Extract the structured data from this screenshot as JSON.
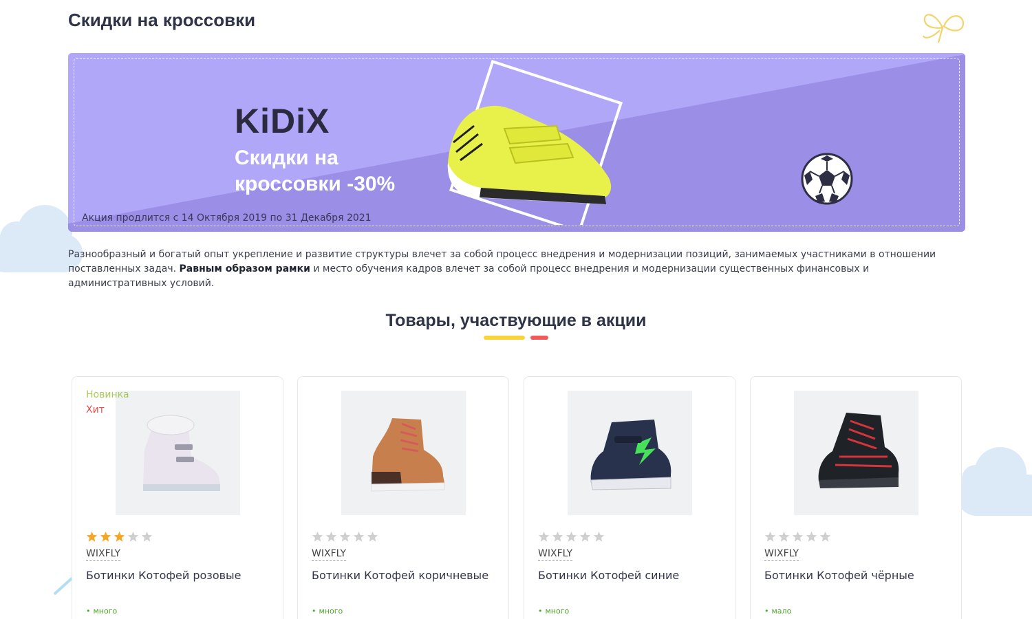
{
  "page": {
    "title": "Скидки на кроссовки"
  },
  "banner": {
    "brand": "KiDiX",
    "promo_line1": "Скидки на",
    "promo_line2": "кроссовки -30%",
    "dates": "Акция продлится с 14 Октября 2019 по 31 Декабря 2021",
    "colors": {
      "light": "#b1a7f9",
      "dark": "#9a8ee6",
      "shoe": "#e8f04a"
    }
  },
  "description": {
    "part1": "Разнообразный и богатый опыт укрепление и развитие структуры влечет за собой процесс внедрения и модернизации позиций, занимаемых участниками в отношении поставленных задач. ",
    "bold": "Равным образом рамки",
    "part2": " и место обучения кадров влечет за собой процесс внедрения и модернизации существенных финансовых и административных условий."
  },
  "section": {
    "title": "Товары, участвующие в акции"
  },
  "products": [
    {
      "badge_new": "Новинка",
      "badge_hit": "Хит",
      "rating": 3,
      "brand": "WIXFLY",
      "name": "Ботинки Котофей розовые",
      "stock": "много",
      "color": "#e9e4ee"
    },
    {
      "rating": 0,
      "brand": "WIXFLY",
      "name": "Ботинки Котофей коричневые",
      "stock": "много",
      "color": "#c7804d"
    },
    {
      "rating": 0,
      "brand": "WIXFLY",
      "name": "Ботинки Котофей синие",
      "stock": "много",
      "color": "#28324c"
    },
    {
      "rating": 0,
      "brand": "WIXFLY",
      "name": "Ботинки Котофей чёрные",
      "stock": "мало",
      "color": "#1f2226"
    }
  ]
}
